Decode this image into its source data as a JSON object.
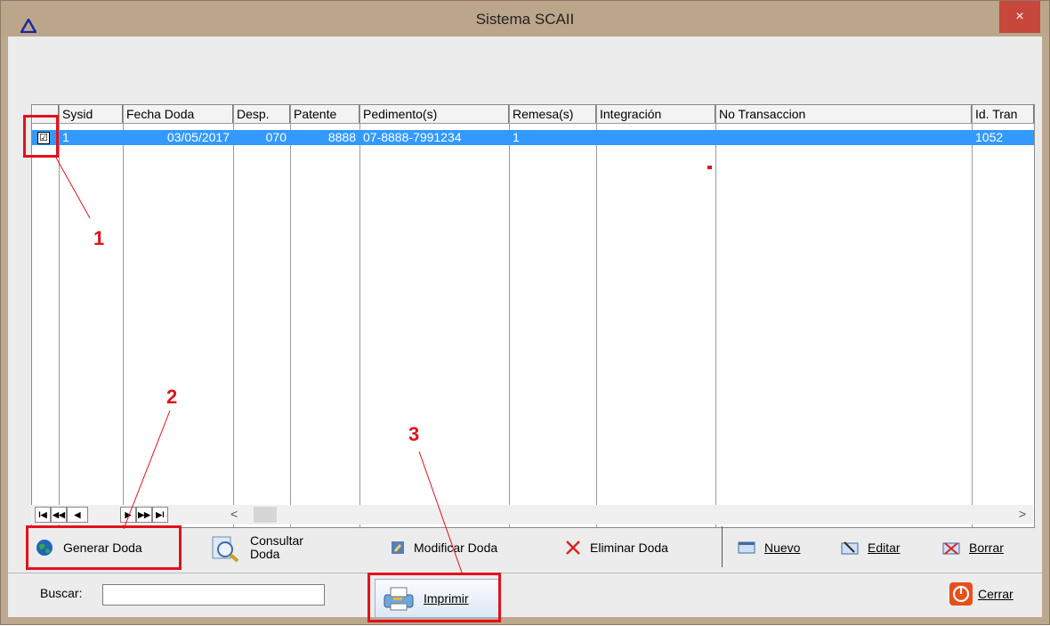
{
  "window": {
    "title": "Sistema SCAII",
    "close_label": "×"
  },
  "table": {
    "columns": [
      "Sysid",
      "Fecha Doda",
      "Desp.",
      "Patente",
      "Pedimento(s)",
      "Remesa(s)",
      "Integración",
      "No Transaccion",
      "Id. Tran"
    ],
    "rows": [
      {
        "checked": "☑",
        "sysid": "1",
        "fecha": "03/05/2017",
        "desp": "070",
        "patente": "8888",
        "pedimento": "07-8888-7991234",
        "remesa": "1",
        "integracion": "",
        "no_transaccion": "",
        "id_tran": "1052"
      }
    ]
  },
  "nav": {
    "first": "I◀",
    "prev_page": "◀◀",
    "prev": "◀",
    "next": "▶",
    "next_page": "▶▶",
    "last": "▶I",
    "scroll_left": "<",
    "scroll_right": ">"
  },
  "toolbar": {
    "generar": "Generar Doda",
    "consultar": "Consultar\nDoda",
    "modificar": "Modificar Doda",
    "eliminar": "Eliminar Doda",
    "nuevo": "Nuevo",
    "editar": "Editar",
    "borrar": "Borrar"
  },
  "bottom": {
    "search_label": "Buscar:",
    "search_value": "",
    "imprimir": "Imprimir",
    "cerrar": "Cerrar"
  },
  "annotations": {
    "one": "1",
    "two": "2",
    "three": "3"
  },
  "colors": {
    "selection": "#3399ff",
    "annotation": "#e3111b",
    "titlebar": "#bba68b"
  }
}
